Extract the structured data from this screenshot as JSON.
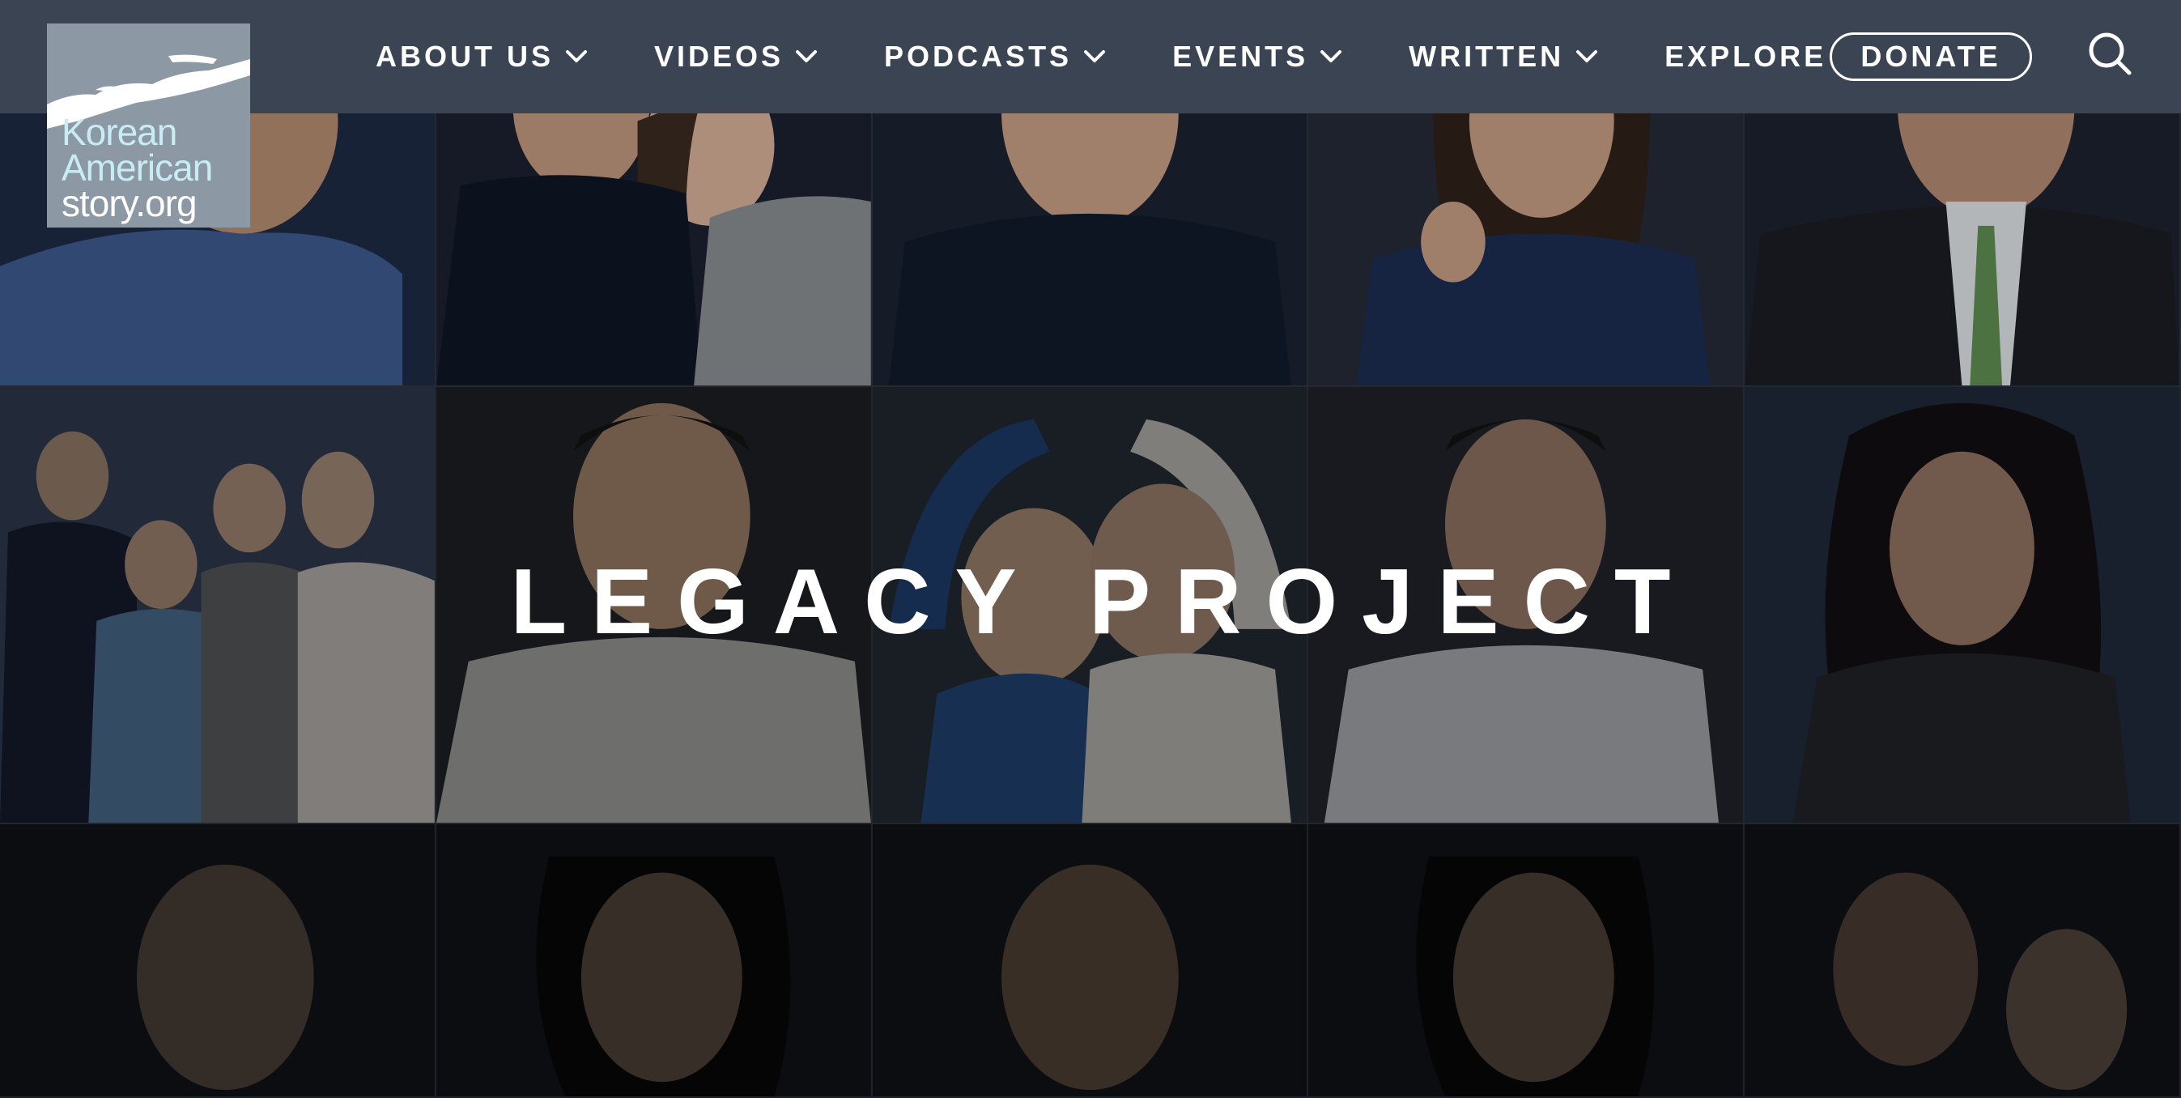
{
  "logo": {
    "line1": "Korean",
    "line2": "American",
    "line3": "story.org"
  },
  "nav": {
    "items": [
      {
        "label": "ABOUT US",
        "has_dropdown": true
      },
      {
        "label": "VIDEOS",
        "has_dropdown": true
      },
      {
        "label": "PODCASTS",
        "has_dropdown": true
      },
      {
        "label": "EVENTS",
        "has_dropdown": true
      },
      {
        "label": "WRITTEN",
        "has_dropdown": true
      },
      {
        "label": "EXPLORE",
        "has_dropdown": false
      }
    ],
    "donate_label": "DONATE",
    "search_icon": "search-icon"
  },
  "hero": {
    "title": "LEGACY PROJECT"
  },
  "colors": {
    "header_bg": "#3b4452",
    "logo_bg": "#8c98a3",
    "logo_accent": "#c7ecf3",
    "text": "#ffffff"
  }
}
